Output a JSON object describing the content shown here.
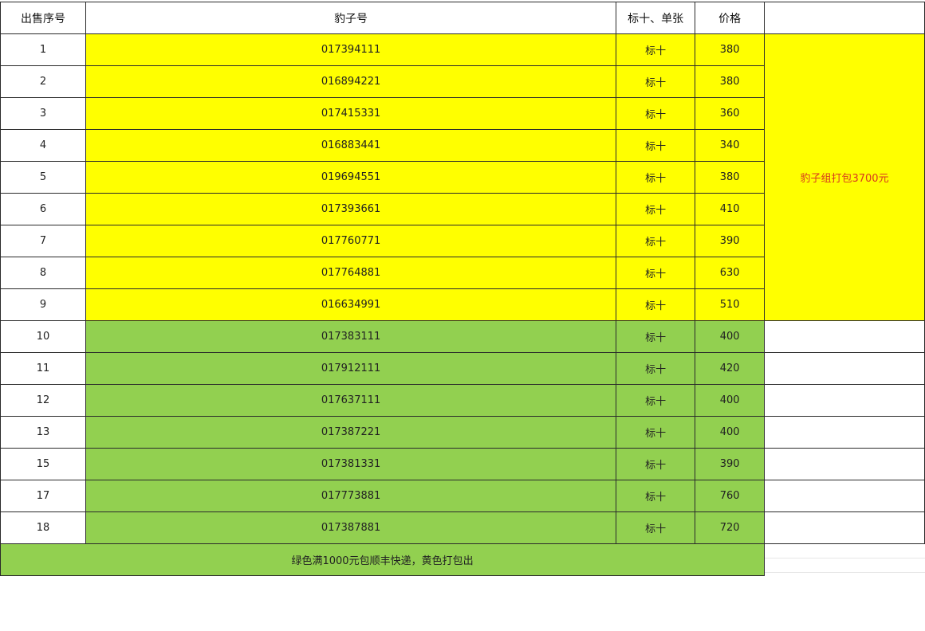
{
  "headers": [
    "出售序号",
    "豹子号",
    "标十、单张",
    "价格"
  ],
  "rows": [
    {
      "seq": "1",
      "code": "017394111",
      "type": "标十",
      "price": "380",
      "color": "yellow"
    },
    {
      "seq": "2",
      "code": "016894221",
      "type": "标十",
      "price": "380",
      "color": "yellow"
    },
    {
      "seq": "3",
      "code": "017415331",
      "type": "标十",
      "price": "360",
      "color": "yellow"
    },
    {
      "seq": "4",
      "code": "016883441",
      "type": "标十",
      "price": "340",
      "color": "yellow"
    },
    {
      "seq": "5",
      "code": "019694551",
      "type": "标十",
      "price": "380",
      "color": "yellow"
    },
    {
      "seq": "6",
      "code": "017393661",
      "type": "标十",
      "price": "410",
      "color": "yellow"
    },
    {
      "seq": "7",
      "code": "017760771",
      "type": "标十",
      "price": "390",
      "color": "yellow"
    },
    {
      "seq": "8",
      "code": "017764881",
      "type": "标十",
      "price": "630",
      "color": "yellow"
    },
    {
      "seq": "9",
      "code": "016634991",
      "type": "标十",
      "price": "510",
      "color": "yellow"
    },
    {
      "seq": "10",
      "code": "017383111",
      "type": "标十",
      "price": "400",
      "color": "green"
    },
    {
      "seq": "11",
      "code": "017912111",
      "type": "标十",
      "price": "420",
      "color": "green"
    },
    {
      "seq": "12",
      "code": "017637111",
      "type": "标十",
      "price": "400",
      "color": "green"
    },
    {
      "seq": "13",
      "code": "017387221",
      "type": "标十",
      "price": "400",
      "color": "green"
    },
    {
      "seq": "15",
      "code": "017381331",
      "type": "标十",
      "price": "390",
      "color": "green"
    },
    {
      "seq": "17",
      "code": "017773881",
      "type": "标十",
      "price": "760",
      "color": "green"
    },
    {
      "seq": "18",
      "code": "017387881",
      "type": "标十",
      "price": "720",
      "color": "green"
    }
  ],
  "side_note": "豹子组打包3700元",
  "footer_note": "绿色满1000元包顺丰快递，黄色打包出",
  "colors": {
    "yellow": "#ffff00",
    "green": "#92d050",
    "note_text": "#d83a1e"
  }
}
